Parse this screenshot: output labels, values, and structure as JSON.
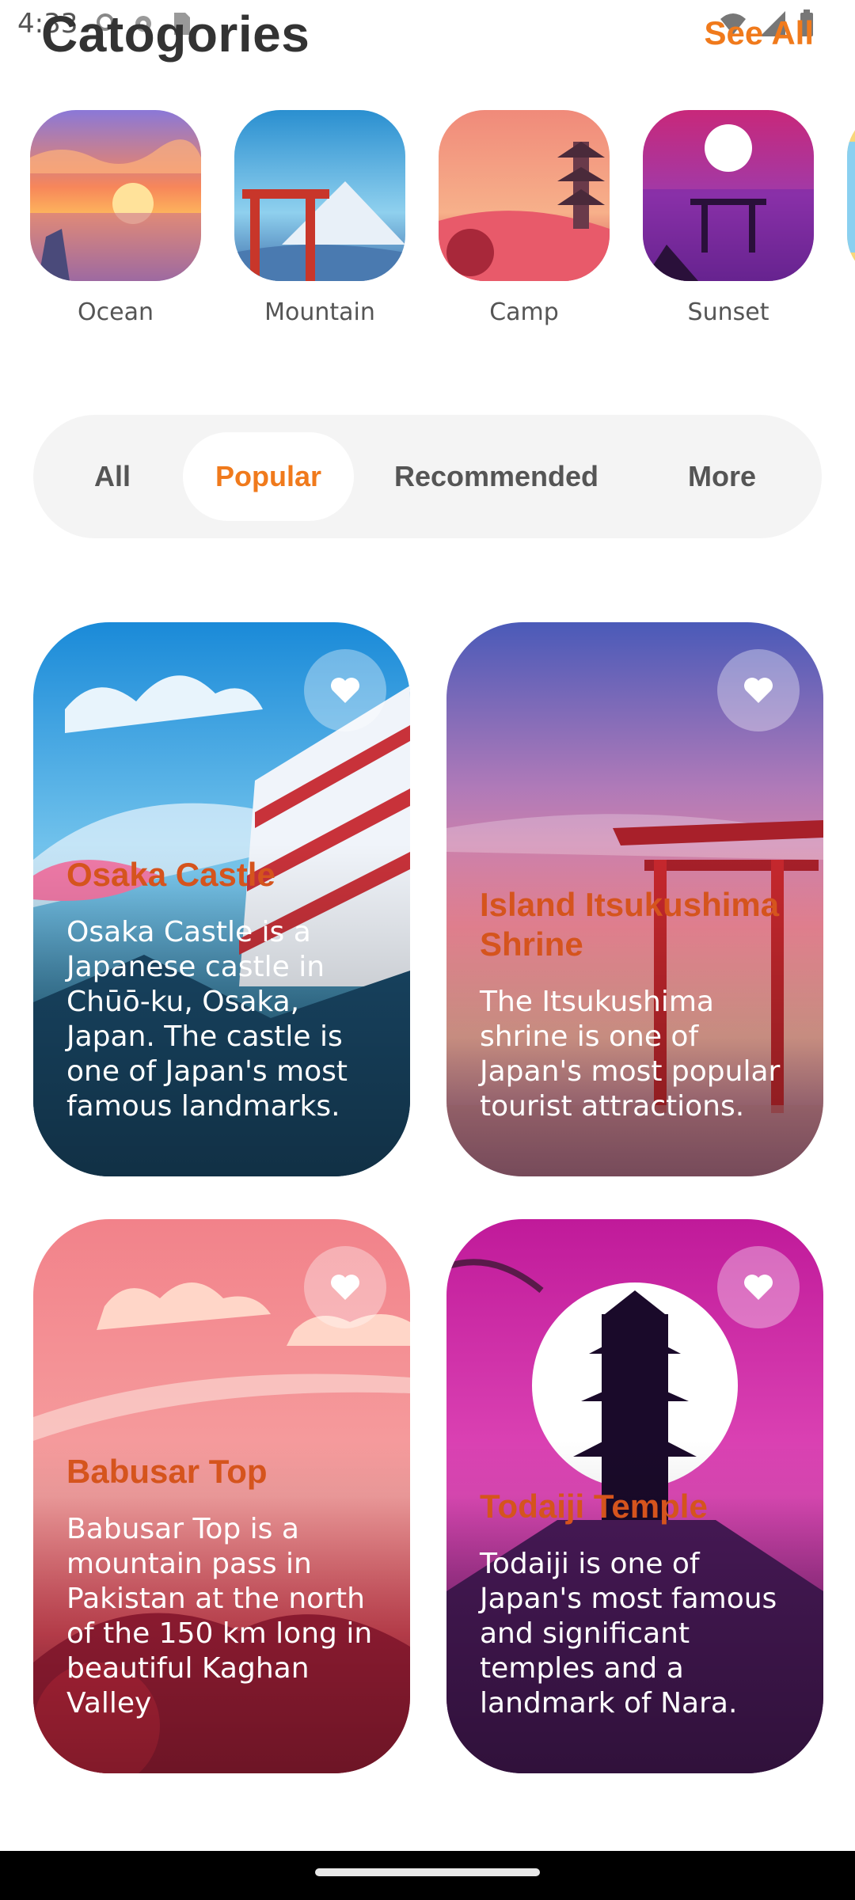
{
  "status_bar": {
    "time": "4:33"
  },
  "header": {
    "title": "Catogories",
    "see_all": "See All"
  },
  "categories": [
    {
      "label": "Ocean"
    },
    {
      "label": "Mountain"
    },
    {
      "label": "Camp"
    },
    {
      "label": "Sunset"
    }
  ],
  "tabs": [
    {
      "label": "All"
    },
    {
      "label": "Popular",
      "active": true
    },
    {
      "label": "Recommended"
    },
    {
      "label": "More"
    }
  ],
  "cards": [
    {
      "title": "Osaka Castle",
      "description": "Osaka Castle is a Japanese castle in Chūō-ku, Osaka, Japan. The castle is one of Japan's most famous landmarks."
    },
    {
      "title": "Island Itsukushima Shrine",
      "description": "The Itsukushima shrine is one of Japan's most popular tourist attractions."
    },
    {
      "title": "Babusar Top",
      "description": "Babusar Top is a mountain pass in Pakistan at the north of the 150 km long in beautiful Kaghan Valley"
    },
    {
      "title": "Todaiji Temple",
      "description": "Todaiji is one of Japan's most famous and significant temples and a landmark of Nara."
    }
  ],
  "colors": {
    "accent": "#f07a1c",
    "card_title": "#d5541d",
    "tab_bg": "#f4f4f4"
  }
}
